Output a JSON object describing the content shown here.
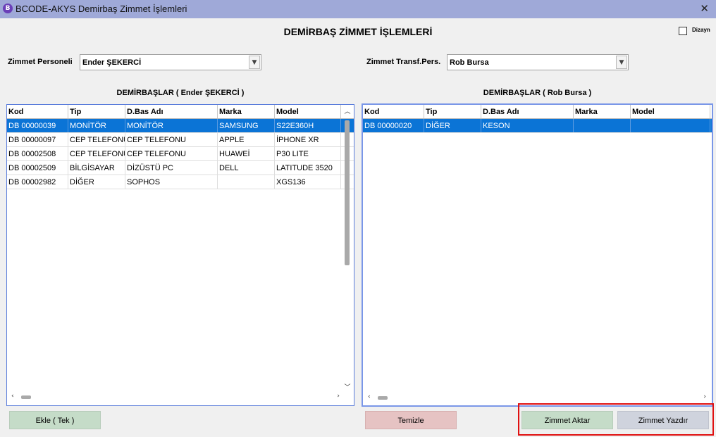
{
  "window": {
    "logo_letter": "B",
    "title": "BCODE-AKYS Demirbaş Zimmet İşlemleri",
    "close_glyph": "✕"
  },
  "page_title": "DEMİRBAŞ ZİMMET İŞLEMLERİ",
  "design_checkbox": {
    "label": "Dizayn",
    "checked": false
  },
  "left_field": {
    "label": "Zimmet Personeli",
    "value": "Ender ŞEKERCİ"
  },
  "right_field": {
    "label": "Zimmet Transf.Pers.",
    "value": "Rob Bursa"
  },
  "left_grid": {
    "title": "DEMİRBAŞLAR ( Ender ŞEKERCİ )",
    "columns": [
      "Kod",
      "Tip",
      "D.Bas Adı",
      "Marka",
      "Model"
    ],
    "rows": [
      [
        "DB 00000039",
        "MONİTÖR",
        "MONİTÖR",
        "SAMSUNG",
        "S22E360H"
      ],
      [
        "DB 00000097",
        "CEP TELEFONU",
        "CEP TELEFONU",
        "APPLE",
        "İPHONE XR"
      ],
      [
        "DB 00002508",
        "CEP TELEFONU",
        "CEP TELEFONU",
        "HUAWEİ",
        "P30 LITE"
      ],
      [
        "DB 00002509",
        "BİLGİSAYAR",
        "DİZÜSTÜ PC",
        "DELL",
        "LATITUDE 3520"
      ],
      [
        "DB 00002982",
        "DİĞER",
        "SOPHOS",
        "",
        "XGS136"
      ]
    ],
    "selected_row": 0
  },
  "right_grid": {
    "title": "DEMİRBAŞLAR ( Rob Bursa )",
    "columns": [
      "Kod",
      "Tip",
      "D.Bas Adı",
      "Marka",
      "Model"
    ],
    "rows": [
      [
        "DB 00000020",
        "DİĞER",
        "KESON",
        "",
        ""
      ]
    ],
    "selected_row": 0
  },
  "buttons": {
    "add_single": "Ekle ( Tek )",
    "clear": "Temizle",
    "transfer": "Zimmet Aktar",
    "print": "Zimmet Yazdır"
  },
  "colors": {
    "titlebar": "#9fa9d8",
    "selection": "#0b74d6",
    "highlight": "#e01010"
  }
}
